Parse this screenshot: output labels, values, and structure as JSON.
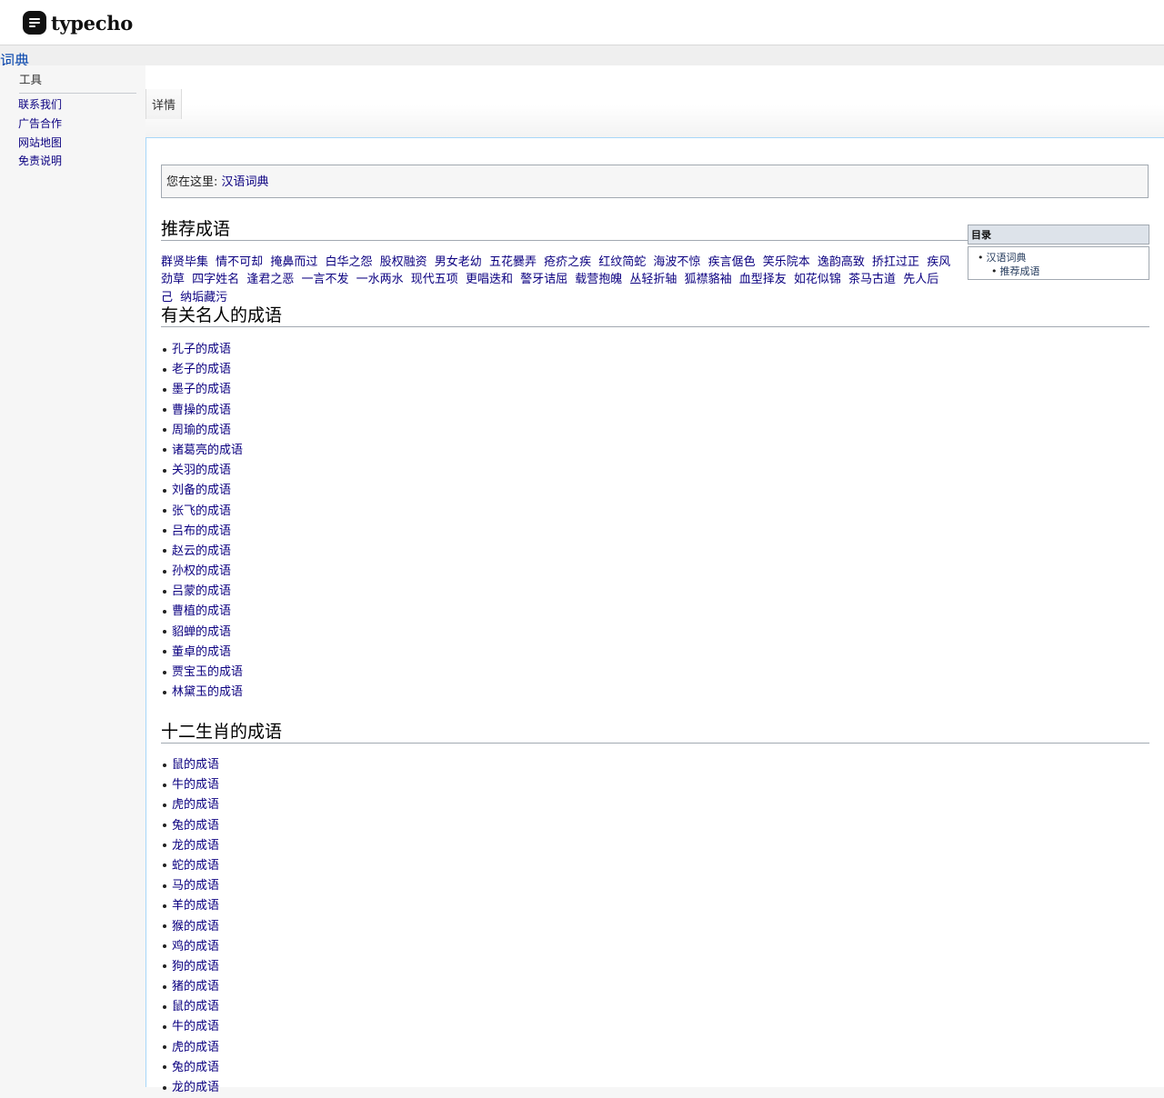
{
  "header": {
    "logo_text": "typecho"
  },
  "site": {
    "title": "词典"
  },
  "sidebar": {
    "heading": "工具",
    "items": [
      {
        "label": "联系我们"
      },
      {
        "label": "广告合作"
      },
      {
        "label": "网站地图"
      },
      {
        "label": "免责说明"
      }
    ]
  },
  "tabs": {
    "detail": "详情"
  },
  "breadcrumb": {
    "prefix": "您在这里: ",
    "link": "汉语词典"
  },
  "toc": {
    "title": "目录",
    "items": [
      "汉语词典",
      "推荐成语"
    ]
  },
  "sections": {
    "recommend": {
      "title": "推荐成语",
      "links": [
        "群贤毕集",
        "情不可却",
        "掩鼻而过",
        "白华之怨",
        "股权融资",
        "男女老幼",
        "五花爨弄",
        "疮疥之疾",
        "红纹简蛇",
        "海波不惊",
        "疾言倨色",
        "笑乐院本",
        "逸韵高致",
        "挢扛过正",
        "疾风劲草",
        "四字姓名",
        "逢君之恶",
        "一言不发",
        "一水两水",
        "现代五项",
        "更唱迭和",
        "謷牙诘屈",
        "载营抱魄",
        "丛轻折轴",
        "狐襟貉袖",
        "血型择友",
        "如花似锦",
        "茶马古道",
        "先人后己",
        "纳垢藏污"
      ]
    },
    "famous": {
      "title": "有关名人的成语",
      "items": [
        "孔子的成语",
        "老子的成语",
        "墨子的成语",
        "曹操的成语",
        "周瑜的成语",
        "诸葛亮的成语",
        "关羽的成语",
        "刘备的成语",
        "张飞的成语",
        "吕布的成语",
        "赵云的成语",
        "孙权的成语",
        "吕蒙的成语",
        "曹植的成语",
        "貂蝉的成语",
        "董卓的成语",
        "贾宝玉的成语",
        "林黛玉的成语"
      ]
    },
    "zodiac": {
      "title": "十二生肖的成语",
      "items": [
        "鼠的成语",
        "牛的成语",
        "虎的成语",
        "兔的成语",
        "龙的成语",
        "蛇的成语",
        "马的成语",
        "羊的成语",
        "猴的成语",
        "鸡的成语",
        "狗的成语",
        "猪的成语",
        "鼠的成语",
        "牛的成语",
        "虎的成语",
        "兔的成语",
        "龙的成语"
      ]
    }
  }
}
